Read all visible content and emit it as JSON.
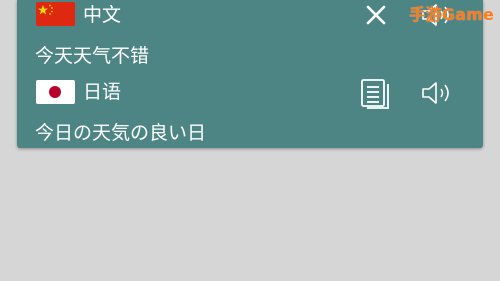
{
  "source": {
    "language_label": "中文",
    "text": "今天天气不错",
    "flag_icon": "china-flag-icon"
  },
  "target": {
    "language_label": "日语",
    "text": "今日の天気の良い日",
    "flag_icon": "japan-flag-icon"
  },
  "icons": {
    "close": "close-icon",
    "speaker": "speaker-icon",
    "copy": "copy-icon"
  },
  "watermark": "手游Game",
  "colors": {
    "card_background": "#4d8585",
    "page_background": "#d6d6d6",
    "text": "#ffffff",
    "watermark": "#ff7a1a"
  }
}
